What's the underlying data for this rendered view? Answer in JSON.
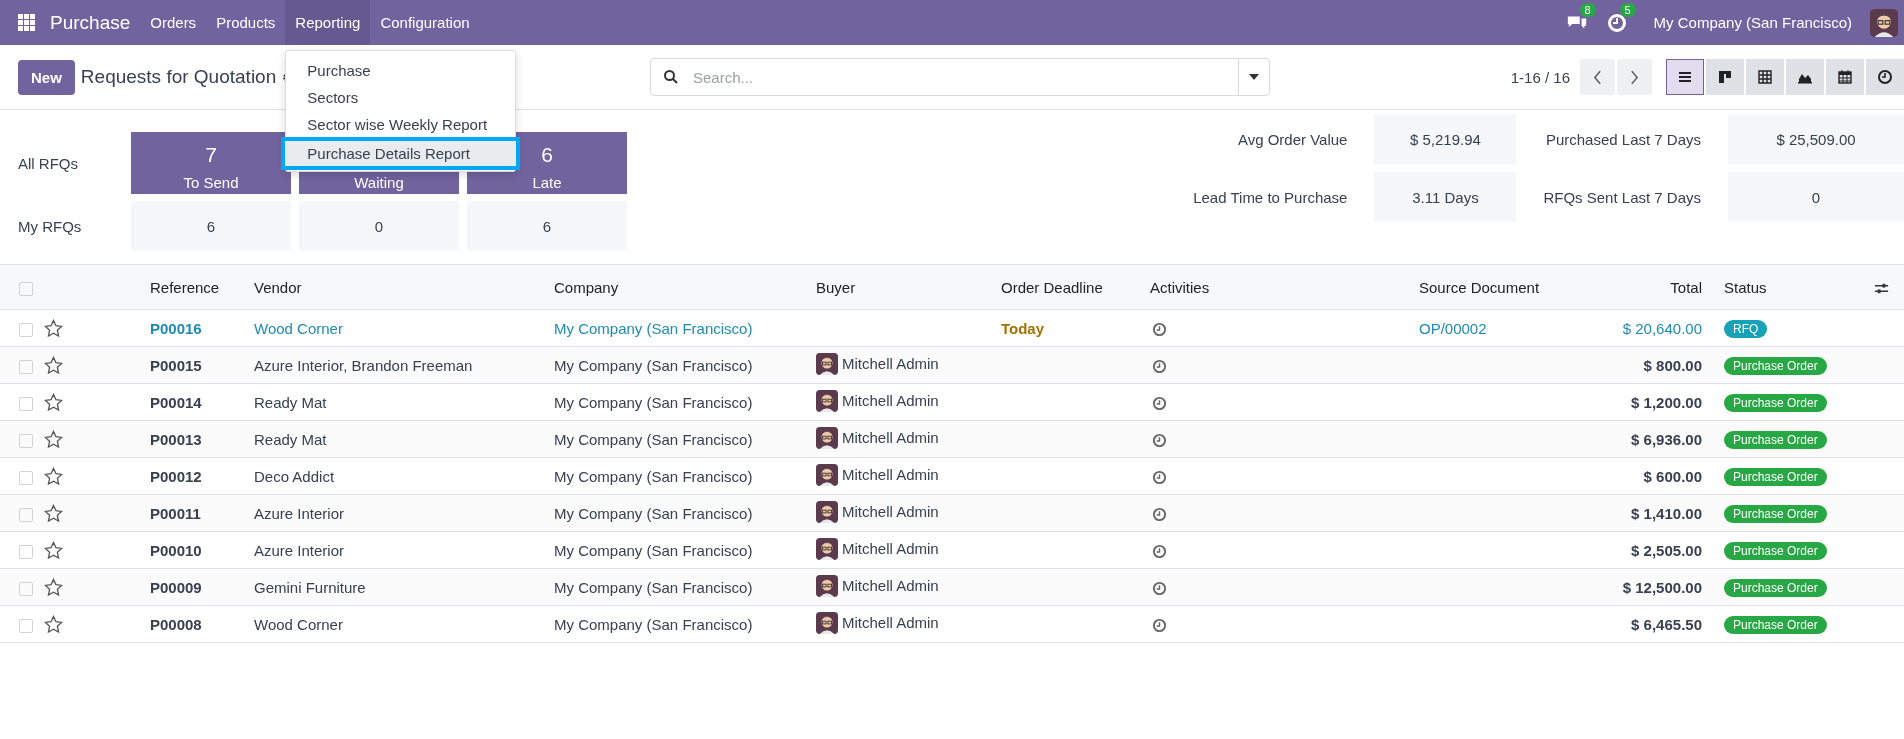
{
  "navbar": {
    "app_name": "Purchase",
    "menu": [
      {
        "label": "Orders",
        "selected": false
      },
      {
        "label": "Products",
        "selected": false
      },
      {
        "label": "Reporting",
        "selected": true
      },
      {
        "label": "Configuration",
        "selected": false
      }
    ],
    "messages_count": "8",
    "activities_count": "5",
    "company": "My Company (San Francisco)"
  },
  "reporting_menu": {
    "items": [
      {
        "label": "Purchase",
        "selected": false
      },
      {
        "label": "Sectors",
        "selected": false
      },
      {
        "label": "Sector wise Weekly Report",
        "selected": false
      },
      {
        "label": "Purchase Details Report",
        "selected": true
      }
    ]
  },
  "control_panel": {
    "new_button": "New",
    "title": "Requests for Quotation",
    "search": {
      "placeholder": "Search..."
    },
    "pager": "1-16 / 16",
    "views": [
      {
        "kind": "list",
        "selected": true
      },
      {
        "kind": "kanban",
        "selected": false
      },
      {
        "kind": "pivot",
        "selected": false
      },
      {
        "kind": "graph",
        "selected": false
      },
      {
        "kind": "calendar",
        "selected": false
      },
      {
        "kind": "activity",
        "selected": false
      }
    ]
  },
  "dashboard": {
    "all_label": "All RFQs",
    "my_label": "My RFQs",
    "tiles": [
      {
        "count": "7",
        "label": "To Send",
        "mine": "6"
      },
      {
        "label": "Waiting",
        "mine": "0"
      },
      {
        "count": "6",
        "label": "Late",
        "mine": "6"
      }
    ],
    "stats": [
      {
        "label": "Avg Order Value",
        "value": "$ 5,219.94"
      },
      {
        "label": "Purchased Last 7 Days",
        "value": "$ 25,509.00"
      },
      {
        "label": "Lead Time to Purchase",
        "value": "3.11 Days"
      },
      {
        "label": "RFQs Sent Last 7 Days",
        "value": "0"
      }
    ]
  },
  "table": {
    "all_selected": false,
    "columns": [
      "Reference",
      "Vendor",
      "Company",
      "Buyer",
      "Order Deadline",
      "Activities",
      "Source Document",
      "Total",
      "Status"
    ],
    "rows": [
      {
        "selected": false,
        "starred": false,
        "reference": "P00016",
        "vendor": "Wood Corner",
        "company": "My Company (San Francisco)",
        "deadline": "Today",
        "source": "OP/00002",
        "total": "$ 20,640.00",
        "status": {
          "kind": "rfq",
          "label": "RFQ"
        }
      },
      {
        "selected": false,
        "starred": false,
        "reference": "P00015",
        "vendor": "Azure Interior, Brandon Freeman",
        "company": "My Company (San Francisco)",
        "buyer": "Mitchell Admin",
        "total": "$ 800.00",
        "status": {
          "kind": "purchase",
          "label": "Purchase Order"
        }
      },
      {
        "selected": false,
        "starred": false,
        "reference": "P00014",
        "vendor": "Ready Mat",
        "company": "My Company (San Francisco)",
        "buyer": "Mitchell Admin",
        "total": "$ 1,200.00",
        "status": {
          "kind": "purchase",
          "label": "Purchase Order"
        }
      },
      {
        "selected": false,
        "starred": false,
        "reference": "P00013",
        "vendor": "Ready Mat",
        "company": "My Company (San Francisco)",
        "buyer": "Mitchell Admin",
        "total": "$ 6,936.00",
        "status": {
          "kind": "purchase",
          "label": "Purchase Order"
        }
      },
      {
        "selected": false,
        "starred": false,
        "reference": "P00012",
        "vendor": "Deco Addict",
        "company": "My Company (San Francisco)",
        "buyer": "Mitchell Admin",
        "total": "$ 600.00",
        "status": {
          "kind": "purchase",
          "label": "Purchase Order"
        }
      },
      {
        "selected": false,
        "starred": false,
        "reference": "P00011",
        "vendor": "Azure Interior",
        "company": "My Company (San Francisco)",
        "buyer": "Mitchell Admin",
        "total": "$ 1,410.00",
        "status": {
          "kind": "purchase",
          "label": "Purchase Order"
        }
      },
      {
        "selected": false,
        "starred": false,
        "reference": "P00010",
        "vendor": "Azure Interior",
        "company": "My Company (San Francisco)",
        "buyer": "Mitchell Admin",
        "total": "$ 2,505.00",
        "status": {
          "kind": "purchase",
          "label": "Purchase Order"
        }
      },
      {
        "selected": false,
        "starred": false,
        "reference": "P00009",
        "vendor": "Gemini Furniture",
        "company": "My Company (San Francisco)",
        "buyer": "Mitchell Admin",
        "total": "$ 12,500.00",
        "status": {
          "kind": "purchase",
          "label": "Purchase Order"
        }
      },
      {
        "selected": false,
        "starred": false,
        "reference": "P00008",
        "vendor": "Wood Corner",
        "company": "My Company (San Francisco)",
        "buyer": "Mitchell Admin",
        "total": "$ 6,465.50",
        "status": {
          "kind": "purchase",
          "label": "Purchase Order"
        }
      }
    ]
  }
}
